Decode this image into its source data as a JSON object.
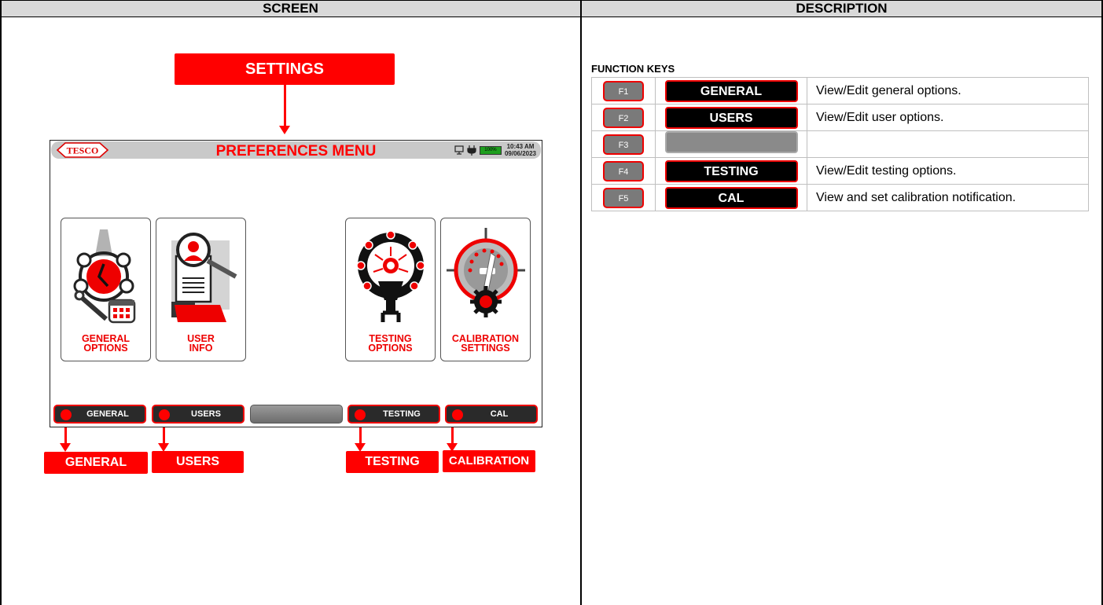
{
  "headers": {
    "screen": "SCREEN",
    "description": "DESCRIPTION"
  },
  "callouts": {
    "settings": "SETTINGS",
    "general": "GENERAL",
    "users": "USERS",
    "testing": "TESTING",
    "calibration": "CALIBRATION"
  },
  "device": {
    "title": "PREFERENCES MENU",
    "logo_text": "TESCO",
    "battery": "100%",
    "time": "10:43 AM",
    "date": "09/06/2023",
    "tiles": [
      {
        "line1": "GENERAL",
        "line2": "OPTIONS",
        "icon": "general-options-icon"
      },
      {
        "line1": "USER",
        "line2": "INFO",
        "icon": "user-info-icon"
      },
      {
        "line1": "TESTING",
        "line2": "OPTIONS",
        "icon": "testing-options-icon"
      },
      {
        "line1": "CALIBRATION",
        "line2": "SETTINGS",
        "icon": "calibration-settings-icon"
      }
    ],
    "softkeys": [
      "GENERAL",
      "USERS",
      "",
      "TESTING",
      "CAL"
    ]
  },
  "function_keys": {
    "title": "FUNCTION KEYS",
    "rows": [
      {
        "key": "F1",
        "softkey": "GENERAL",
        "description": "View/Edit general options."
      },
      {
        "key": "F2",
        "softkey": "USERS",
        "description": "View/Edit user options."
      },
      {
        "key": "F3",
        "softkey": "",
        "description": ""
      },
      {
        "key": "F4",
        "softkey": "TESTING",
        "description": "View/Edit testing options."
      },
      {
        "key": "F5",
        "softkey": "CAL",
        "description": "View and set calibration notification."
      }
    ]
  },
  "colors": {
    "accent": "#ff0000",
    "header_bg": "#d9d9d9",
    "battery": "#1e9e1e"
  }
}
